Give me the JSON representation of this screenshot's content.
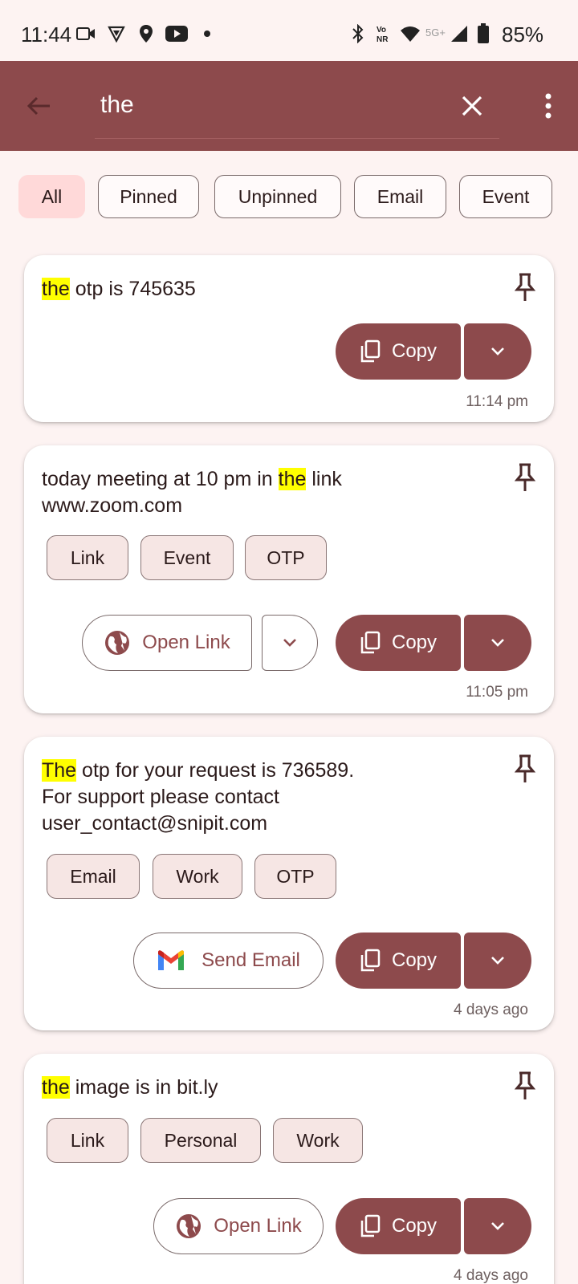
{
  "status_bar": {
    "time": "11:44",
    "battery": "85%",
    "network": "5G+"
  },
  "search": {
    "query": "the"
  },
  "filters": [
    {
      "label": "All",
      "active": true
    },
    {
      "label": "Pinned",
      "active": false
    },
    {
      "label": "Unpinned",
      "active": false
    },
    {
      "label": "Email",
      "active": false
    },
    {
      "label": "Event",
      "active": false
    }
  ],
  "cards": [
    {
      "text_parts": [
        "the",
        " otp is 745635"
      ],
      "time": "11:14 pm",
      "copy_label": "Copy"
    },
    {
      "text_parts": [
        "today meeting at 10 pm in ",
        "the",
        " link",
        "www.zoom.com"
      ],
      "tags": [
        "Link",
        "Event",
        "OTP"
      ],
      "action_label": "Open Link",
      "copy_label": "Copy",
      "time": "11:05 pm"
    },
    {
      "text_parts": [
        "The",
        " otp for your request is 736589.",
        "For support please contact",
        "user_contact@snipit.com"
      ],
      "tags": [
        "Email",
        "Work",
        "OTP"
      ],
      "action_label": "Send Email",
      "copy_label": "Copy",
      "time": "4 days ago"
    },
    {
      "text_parts": [
        "the",
        " image is in bit.ly"
      ],
      "tags": [
        "Link",
        "Personal",
        "Work"
      ],
      "action_label": "Open Link",
      "copy_label": "Copy",
      "time": "4 days ago"
    }
  ],
  "colors": {
    "primary": "#8d4a4c",
    "highlight": "#ffff00",
    "background": "#fdf3f2",
    "chip_active": "#ffd9d9"
  }
}
